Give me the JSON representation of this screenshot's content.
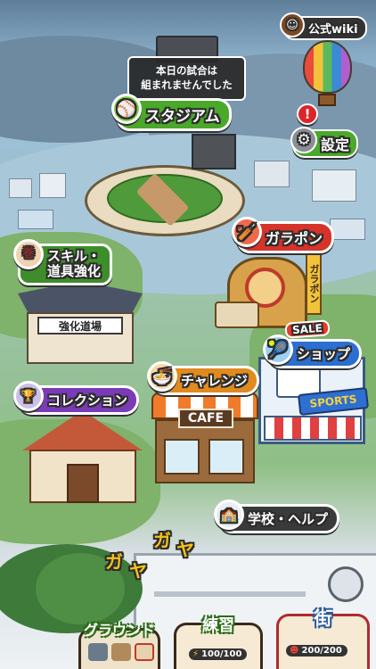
{
  "map": {
    "stadium_notice": "本日の試合は\n組まれませんでした",
    "stadium_label": "スタジアム",
    "wiki_label": "公式wiki",
    "settings_label": "設定",
    "alert_mark": "!",
    "gacha_label": "ガラポン",
    "gacha_sign": "ガラポン",
    "skill_label_line1": "スキル・",
    "skill_label_line2": "道具強化",
    "dojo_sign": "強化道場",
    "challenge_label": "チャレンジ",
    "shop_badge": "SALE",
    "shop_label": "ショップ",
    "sports_sign": "SPORTS",
    "collection_label": "コレクション",
    "cafe_sign": "CAFE",
    "school_help_label": "学校・ヘルプ",
    "sfx_ga1": "ガ",
    "sfx_ya1": "ヤ",
    "sfx_ga2": "ガ",
    "sfx_ya2": "ヤ"
  },
  "dock": {
    "ground_label": "グラウンド",
    "practice_label": "練習",
    "practice_count": "100/100",
    "town_label": "街",
    "town_count": "200/200"
  },
  "colors": {
    "stadium_green": "#4aa82a",
    "gacha_red": "#d6332a",
    "skill_green": "#3d8e2a",
    "shop_blue": "#2a6fd1",
    "collection_purple": "#7b3bb8",
    "challenge_orange": "#e08a1f",
    "school_dark": "#3a3a3a"
  }
}
